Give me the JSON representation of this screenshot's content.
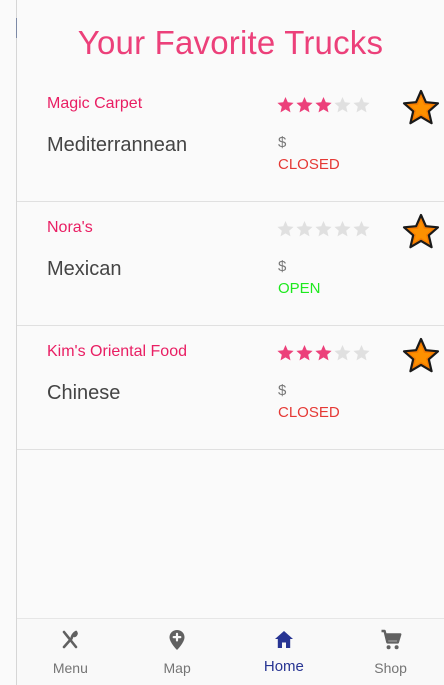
{
  "page_title": "Your Favorite Trucks",
  "colors": {
    "accent": "#ec407a",
    "star_filled": "#ec407a",
    "star_empty": "#e0e0e0",
    "open": "#1de9b6",
    "closed": "#e53935",
    "nav_active": "#283593",
    "nav_inactive": "#616161",
    "favorite_fill": "#f57c00",
    "favorite_outline": "#1a1a1a"
  },
  "trucks": [
    {
      "name": "Magic Carpet",
      "cuisine": "Mediterrannean",
      "rating": 3,
      "rating_max": 5,
      "price": "$",
      "status": "CLOSED",
      "status_color": "#e53935",
      "favorite_icon": "favorite-star-icon"
    },
    {
      "name": "Nora's",
      "cuisine": "Mexican",
      "rating": 0,
      "rating_max": 5,
      "price": "$",
      "status": "OPEN",
      "status_color": "#1de91d",
      "favorite_icon": "favorite-star-icon"
    },
    {
      "name": "Kim's Oriental Food",
      "cuisine": "Chinese",
      "rating": 3,
      "rating_max": 5,
      "price": "$",
      "status": "CLOSED",
      "status_color": "#e53935",
      "favorite_icon": "favorite-star-icon"
    }
  ],
  "bottom_nav": {
    "active": "home",
    "items": [
      {
        "key": "menu",
        "label": "Menu",
        "icon": "fork-spoon-icon"
      },
      {
        "key": "map",
        "label": "Map",
        "icon": "map-pin-plus-icon"
      },
      {
        "key": "home",
        "label": "Home",
        "icon": "home-icon"
      },
      {
        "key": "shop",
        "label": "Shop",
        "icon": "shopping-cart-icon"
      }
    ]
  }
}
